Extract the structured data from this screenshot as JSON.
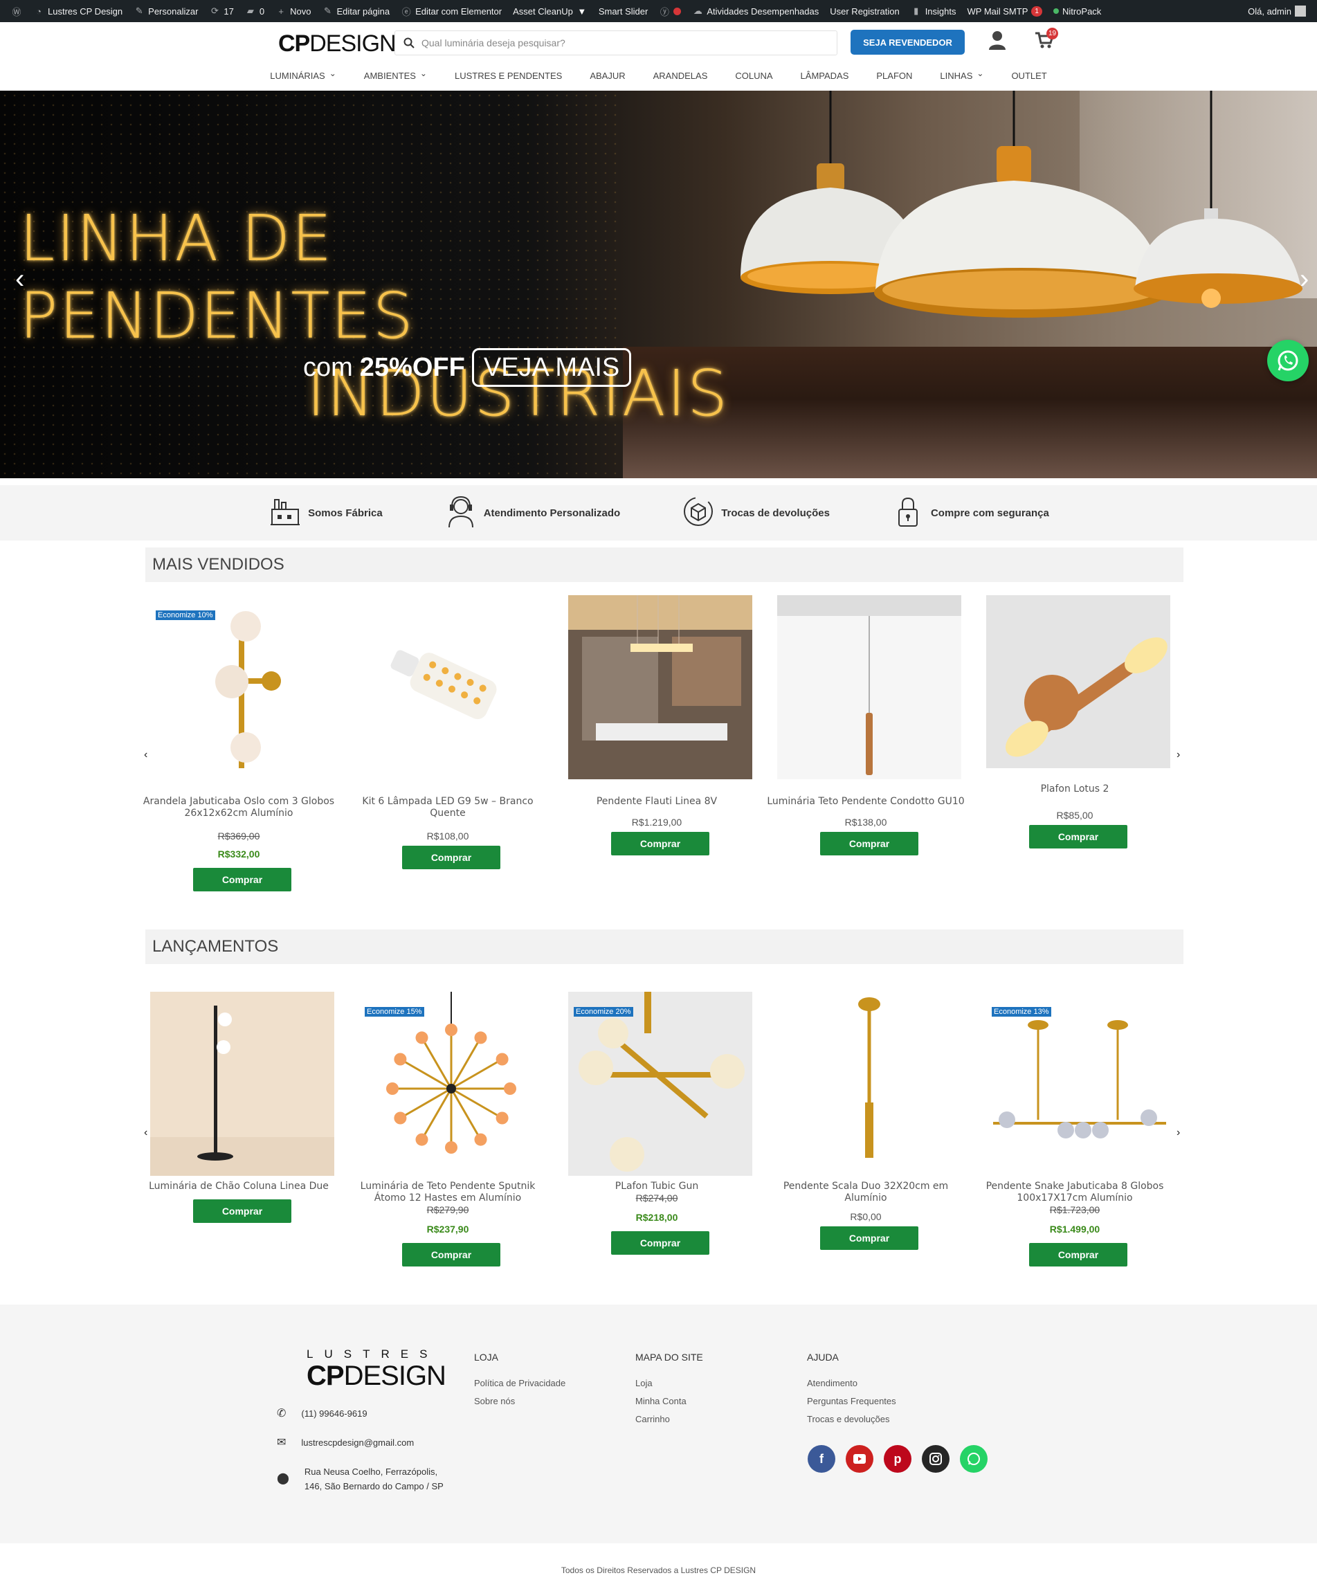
{
  "admin_bar": {
    "site_name": "Lustres CP Design",
    "customize": "Personalizar",
    "updates_count": "17",
    "comments_count": "0",
    "new": "Novo",
    "edit_page": "Editar página",
    "edit_elementor": "Editar com Elementor",
    "asset_cleanup": "Asset CleanUp",
    "smart_slider": "Smart Slider",
    "activities": "Atividades Desempenhadas",
    "user_registration": "User Registration",
    "insights": "Insights",
    "wp_mail_smtp": "WP Mail SMTP",
    "wp_mail_badge": "1",
    "nitropack": "NitroPack",
    "greeting": "Olá, admin"
  },
  "header": {
    "logo_bold": "CP",
    "logo_light": "DESIGN",
    "search_placeholder": "Qual luminária deseja pesquisar?",
    "reseller_button": "SEJA REVENDEDOR",
    "cart_count": "19",
    "nav": [
      {
        "label": "LUMINÁRIAS",
        "dropdown": true
      },
      {
        "label": "AMBIENTES",
        "dropdown": true
      },
      {
        "label": "LUSTRES E PENDENTES",
        "dropdown": false
      },
      {
        "label": "ABAJUR",
        "dropdown": false
      },
      {
        "label": "ARANDELAS",
        "dropdown": false
      },
      {
        "label": "COLUNA",
        "dropdown": false
      },
      {
        "label": "LÂMPADAS",
        "dropdown": false
      },
      {
        "label": "PLAFON",
        "dropdown": false
      },
      {
        "label": "LINHAS",
        "dropdown": true
      },
      {
        "label": "OUTLET",
        "dropdown": false
      }
    ]
  },
  "hero": {
    "title_line1": "LINHA DE PENDENTES",
    "title_line2": "INDUSTRIAIS",
    "sub_prefix": "com",
    "sub_discount": "25%OFF",
    "cta": "VEJA MAIS",
    "accent_color": "#f7c24c"
  },
  "features": [
    {
      "icon": "factory-icon",
      "label": "Somos Fábrica"
    },
    {
      "icon": "headset-icon",
      "label": "Atendimento Personalizado"
    },
    {
      "icon": "box-return-icon",
      "label": "Trocas de devoluções"
    },
    {
      "icon": "lock-icon",
      "label": "Compre com segurança"
    }
  ],
  "best_sellers": {
    "title": "MAIS VENDIDOS",
    "products": [
      {
        "badge": "Economize 10%",
        "name": "Arandela Jabuticaba Oslo com 3 Globos 26x12x62cm Alumínio",
        "old_price": "R$369,00",
        "price": "R$332,00",
        "button": "Comprar"
      },
      {
        "badge": "",
        "name": "Kit 6 Lâmpada LED G9 5w – Branco Quente",
        "old_price": "",
        "price": "R$108,00",
        "button": "Comprar"
      },
      {
        "badge": "",
        "name": "Pendente Flauti Linea 8V",
        "old_price": "",
        "price": "R$1.219,00",
        "button": "Comprar"
      },
      {
        "badge": "",
        "name": "Luminária Teto Pendente Condotto GU10",
        "old_price": "",
        "price": "R$138,00",
        "button": "Comprar"
      },
      {
        "badge": "",
        "name": "Plafon Lotus 2",
        "old_price": "",
        "price": "R$85,00",
        "button": "Comprar"
      }
    ]
  },
  "launches": {
    "title": "LANÇAMENTOS",
    "products": [
      {
        "badge": "",
        "name": "Luminária de Chão Coluna Linea Due",
        "old_price": "",
        "price": "",
        "button": "Comprar"
      },
      {
        "badge": "Economize 15%",
        "name": "Luminária de Teto Pendente Sputnik Átomo 12 Hastes em Alumínio",
        "old_price": "R$279,90",
        "price": "R$237,90",
        "button": "Comprar"
      },
      {
        "badge": "Economize 20%",
        "name": "PLafon Tubic Gun",
        "old_price": "R$274,00",
        "price": "R$218,00",
        "button": "Comprar"
      },
      {
        "badge": "",
        "name": "Pendente Scala Duo 32X20cm em Alumínio",
        "old_price": "",
        "price": "R$0,00",
        "button": "Comprar"
      },
      {
        "badge": "Economize 13%",
        "name": "Pendente Snake Jabuticaba 8 Globos 100x17X17cm Alumínio",
        "old_price": "R$1.723,00",
        "price": "R$1.499,00",
        "button": "Comprar"
      }
    ]
  },
  "footer": {
    "logo_top": "LUSTRES",
    "logo_bold": "CP",
    "logo_light": "DESIGN",
    "phone": "(11) 99646-9619",
    "email": "lustrescpdesign@gmail.com",
    "address_line1": "Rua Neusa Coelho, Ferrazópolis,",
    "address_line2": "146, São Bernardo do Campo / SP",
    "columns": [
      {
        "title": "LOJA",
        "links": [
          "Política de Privacidade",
          "Sobre nós"
        ]
      },
      {
        "title": "MAPA DO SITE",
        "links": [
          "Loja",
          "Minha Conta",
          "Carrinho"
        ]
      },
      {
        "title": "AJUDA",
        "links": [
          "Atendimento",
          "Perguntas Frequentes",
          "Trocas e devoluções"
        ]
      }
    ],
    "social": [
      {
        "icon": "facebook-icon",
        "color": "#3b5998"
      },
      {
        "icon": "youtube-icon",
        "color": "#cd201f"
      },
      {
        "icon": "pinterest-icon",
        "color": "#bd081c"
      },
      {
        "icon": "instagram-icon",
        "color": "#262626"
      },
      {
        "icon": "whatsapp-icon",
        "color": "#25d366"
      }
    ],
    "copyright": "Todos os Direitos Reservados a Lustres CP DESIGN"
  }
}
